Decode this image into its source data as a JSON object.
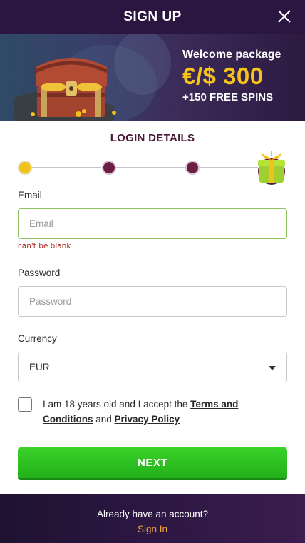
{
  "header": {
    "title": "SIGN UP",
    "close_icon": "close-icon"
  },
  "banner": {
    "welcome": "Welcome package",
    "amount": "€/$ 300",
    "spins": "+150 FREE SPINS",
    "art_icon": "treasure-chest-icon"
  },
  "section_title": "LOGIN DETAILS",
  "stepper": {
    "current_step": 1,
    "total_steps": 4,
    "final_icon": "gift-icon"
  },
  "form": {
    "email_label": "Email",
    "email_placeholder": "Email",
    "email_error": "can't be blank",
    "password_label": "Password",
    "password_placeholder": "Password",
    "currency_label": "Currency",
    "currency_value": "EUR",
    "terms_prefix": "I am 18 years old and I accept the ",
    "terms_link": "Terms and Conditions",
    "terms_middle": " and ",
    "privacy_link": "Privacy Policy"
  },
  "next_button": "NEXT",
  "footer": {
    "prompt": "Already have an account?",
    "signin": "Sign In"
  },
  "colors": {
    "header_bg": "#2a1640",
    "accent_gold": "#f6c21c",
    "step_pending": "#6b1f45",
    "button_green": "#2cc11f",
    "error_red": "#b0281e",
    "link_orange": "#f2a43a"
  }
}
